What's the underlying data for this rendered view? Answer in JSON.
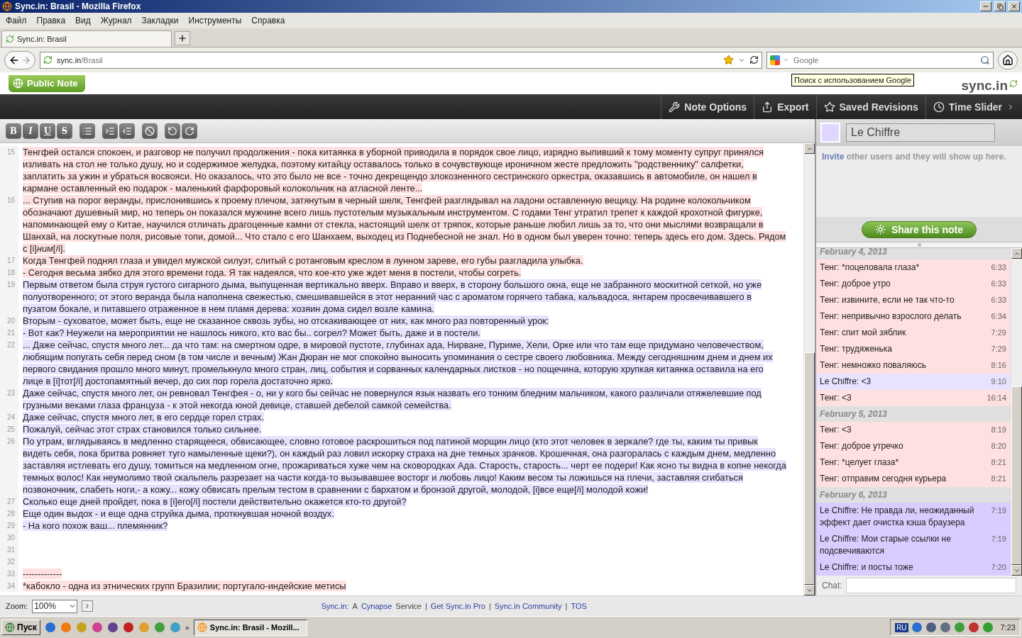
{
  "window": {
    "title": "Sync.in: Brasil - Mozilla Firefox"
  },
  "menu": [
    "Файл",
    "Правка",
    "Вид",
    "Журнал",
    "Закладки",
    "Инструменты",
    "Справка"
  ],
  "tabs": [
    {
      "label": "Sync.in: Brasil",
      "selected": true
    }
  ],
  "address_bar": {
    "host": "sync.in",
    "path": "/Brasil"
  },
  "search": {
    "placeholder": "Google"
  },
  "tooltip": "Поиск с использованием Google",
  "app": {
    "note_badge": "Public Note",
    "logo": "sync.in"
  },
  "note_toolbar": [
    "Note Options",
    "Export",
    "Saved Revisions",
    "Time Slider"
  ],
  "format_buttons": [
    {
      "kind": "bold",
      "label": "B"
    },
    {
      "kind": "italic",
      "label": "I"
    },
    {
      "kind": "underline",
      "label": "U"
    },
    {
      "kind": "strike",
      "label": "S"
    }
  ],
  "editor": {
    "paragraphs": [
      {
        "number": "15",
        "color": "#ffe0e0",
        "parts": [
          {
            "text": "Тенгфей остался спокоен, и разговор не получил продолжения - пока китаянка в уборной приводила в порядок свое лицо, изрядно выпивший к тому моменту супруг принялся изливать на стол не только душу, но и содержимое желудка, поэтому китайцу оставалось только в сочувствующе ироничном жесте предложить \"родственнику\" салфетки, заплатить за ужин и убраться восвояси. Но оказалось, что это было не все - точно декрещендо злокозненного сестринского оркестра, оказавшись в автомобиле, он нашел в кармане оставленный ею подарок - маленький фарфоровый колокольчик на атласной ленте...",
            "italic": false
          }
        ]
      },
      {
        "number": "16",
        "color": "#ffe0e0",
        "parts": [
          {
            "text": "... Ступив на порог веранды, прислонившись к проему плечом, затянутым в черный шелк, Тенгфей разглядывал на ладони оставленную вещицу. На родине колокольчиком обозначают душевный мир, но теперь он показался мужчине всего лишь пустотелым музыкальным инструментом. С годами Тенг утратил трепет к каждой крохотной фигурке, напоминающей ему о Китае, научился отличать драгоценные камни от стекла, настоящий шелк от тряпок, которые раньше любил лишь за то, что они мыслями возвращали в Шанхай, на лоскутные поля, рисовые топи, домой... Что стало с его Шанхаем, выходец из Поднебесной не знал. Но в одном был уверен точно: теперь здесь его дом. Здесь. Рядом с [i]",
            "italic": false
          },
          {
            "text": "ним",
            "italic": true
          },
          {
            "text": "[/i].",
            "italic": false
          }
        ]
      },
      {
        "number": "17",
        "color": "#ffe0e0",
        "parts": [
          {
            "text": "Когда Тенгфей поднял глаза и увидел мужской силуэт, слитый с ротанговым креслом в лунном зареве, его губы разгладила улыбка.",
            "italic": false
          }
        ]
      },
      {
        "number": "18",
        "color": "#ffe0e0",
        "parts": [
          {
            "text": "- Сегодня весьма зябко для этого времени года. Я так надеялся, что кое-кто уже ждет меня в постели, чтобы согреть.",
            "italic": false
          }
        ]
      },
      {
        "number": "19",
        "color": "#e8e2ff",
        "parts": [
          {
            "text": "Первым ответом была струя густого сигарного дыма, выпущенная вертикально вверх. Вправо и вверх, в сторону большого окна, еще не забранного москитной сеткой, но уже полуотворенного; от этого веранда была наполнена свежестью, смешивавшейся в этот неранний час с ароматом горячего табака, кальвадоса, янтарем просвечивавшего в пузатом бокале, и питавшего отраженное в нем пламя дерева: хозяин дома сидел возле камина.",
            "italic": false
          }
        ]
      },
      {
        "number": "20",
        "color": "#e8e2ff",
        "parts": [
          {
            "text": "Вторым - суховатое, может быть, еще не сказанное сквозь зубы, но отскакивающее от них, как много раз повторенный урок:",
            "italic": false
          }
        ]
      },
      {
        "number": "21",
        "color": "#e8e2ff",
        "parts": [
          {
            "text": "- Вот как? Неужели на мероприятии не нашлось никого, кто вас бы.. согрел? Может быть, даже и в постели.",
            "italic": false
          }
        ]
      },
      {
        "number": "22",
        "color": "#e8e2ff",
        "parts": [
          {
            "text": "... Даже сейчас, спустя много лет... да что там: на смертном одре, в мировой пустоте, глубинах ада, Нирване, Пуриме, Хели, Орке или что там еще придумано человечеством, любящим попугать себя перед сном (в том числе и вечным) Жан Дюран не мог спокойно выносить упоминания о сестре своего любовника. Между сегодняшним днем и днем их первого свидания прошло много минут, промелькнуло много стран, лиц, события и сорванных календарных листков - но пощечина, которую хрупкая китаянка оставила на его лице в [i]тот[/i] достопамятный вечер, до сих пор горела достаточно ярко.",
            "italic": false
          }
        ]
      },
      {
        "number": "23",
        "color": "#e8e2ff",
        "parts": [
          {
            "text": "Даже сейчас, спустя много лет, он ревновал Тенгфея - о, ни у кого бы сейчас не повернулся язык назвать его тонким бледним мальчиком, какого различали отяжелевшие под грузными веками глаза француза - к этой некогда юной девице, ставшей дебелой самкой семейства.",
            "italic": false
          }
        ]
      },
      {
        "number": "24",
        "color": "#e8e2ff",
        "parts": [
          {
            "text": "Даже сейчас, спустя много лет, в его сердце горел страх.",
            "italic": false
          }
        ]
      },
      {
        "number": "25",
        "color": "#e8e2ff",
        "parts": [
          {
            "text": "Пожалуй, сейчас этот страх становился только сильнее.",
            "italic": false
          }
        ]
      },
      {
        "number": "26",
        "color": "#e8e2ff",
        "parts": [
          {
            "text": "По утрам, вглядываясь в медленно старящееся, обвисающее, словно готовое раскрошиться под патиной морщин лицо (кто этот человек в зеркале? где ты, каким ты привык видеть себя, пока бритва ровняет туго намыленные щеки?), он каждый раз ловил искорку страха на дне темных зрачков. Крошечная, она разгоралась с каждым днем, медленно заставляя истлевать его душу, томиться на медленном огне, прожариваться хуже чем на сковородках Ада. Старость, старость... черт ее подери! Как ясно ты видна в копне некогда темных волос! Как неумолимо твой скальпель разрезает на части когда-то вызывавшее восторг и любовь лицо! Каким весом ты ложишься на плечи, заставляя сгибаться позвоночник, слабеть ноги,- а кожу... кожу обвисать прелым тестом в сравнении с бархатом и бронзой другой, молодой, [i]все еще[/i] молодой кожи!",
            "italic": false
          }
        ]
      },
      {
        "number": "27",
        "color": "#e8e2ff",
        "parts": [
          {
            "text": "Сколько еще дней пройдет, пока в [i]его[/i] постели действительно окажется кто-то другой?",
            "italic": false
          }
        ]
      },
      {
        "number": "28",
        "color": "#e8e2ff",
        "parts": [
          {
            "text": "Еще один выдох - и еще одна струйка дыма, проткнувшая ночной воздух.",
            "italic": false
          }
        ]
      },
      {
        "number": "29",
        "color": "#e8e2ff",
        "parts": [
          {
            "text": "- На кого похож ваш... племянник?",
            "italic": false
          }
        ]
      },
      {
        "number": "30"
      },
      {
        "number": "31"
      },
      {
        "number": "32"
      },
      {
        "number": "33",
        "color": "#ffe0e0",
        "parts": [
          {
            "text": "-------------",
            "italic": false
          }
        ]
      },
      {
        "number": "34",
        "color": "#ffe0e0",
        "parts": [
          {
            "text": "*кабокло - одна из этнических групп Бразилии; португало-индейские метисы",
            "italic": false
          }
        ]
      }
    ]
  },
  "user": {
    "name": "Le Chiffre",
    "color": "#e0d6ff"
  },
  "invite": {
    "link": "Invite",
    "text": "other users and they will show up here."
  },
  "share_button": "Share this note",
  "chat": [
    {
      "kind": "date",
      "text": "February 4, 2013"
    },
    {
      "kind": "message",
      "text": "Тенг: *поцеловала глаза*",
      "time": "6:33",
      "color": "#ffe0e0"
    },
    {
      "kind": "message",
      "text": "Тенг: доброе утро",
      "time": "6:33",
      "color": "#ffe0e0"
    },
    {
      "kind": "message",
      "text": "Тенг: извините, если не так что-то",
      "time": "6:33",
      "color": "#ffe0e0"
    },
    {
      "kind": "message",
      "text": "Тенг: непривычно взрослого делать",
      "time": "6:34",
      "color": "#ffe0e0"
    },
    {
      "kind": "message",
      "text": "Тенг: спит мой зяблик",
      "time": "7:29",
      "color": "#ffe0e0"
    },
    {
      "kind": "message",
      "text": "Тенг: трудяженька",
      "time": "7:29",
      "color": "#ffe0e0"
    },
    {
      "kind": "message",
      "text": "Тенг: немножко поваляюсь",
      "time": "8:16",
      "color": "#ffe0e0"
    },
    {
      "kind": "message",
      "text": "Le Chiffre: <3",
      "time": "9:10",
      "color": "#e8e2ff"
    },
    {
      "kind": "message",
      "text": "Тенг: <3",
      "time": "16:14",
      "color": "#ffe0e0"
    },
    {
      "kind": "date",
      "text": "February 5, 2013"
    },
    {
      "kind": "message",
      "text": "Тенг: <3",
      "time": "8:19",
      "color": "#ffe0e0"
    },
    {
      "kind": "message",
      "text": "Тенг: доброе утречко",
      "time": "8:20",
      "color": "#ffe0e0"
    },
    {
      "kind": "message",
      "text": "Тенг: *целует глаза*",
      "time": "8:21",
      "color": "#ffe0e0"
    },
    {
      "kind": "message",
      "text": "Тенг: отправим сегодня курьера",
      "time": "8:21",
      "color": "#ffe0e0"
    },
    {
      "kind": "date",
      "text": "February 6, 2013"
    },
    {
      "kind": "message",
      "text": "Le Chiffre: Не правда ли, неожиданный эффект дает очистка кэша браузера",
      "time": "7:19",
      "color": "#d9ccff"
    },
    {
      "kind": "message",
      "text": "Le Chiffre: Мои старые ссылки не подсвечиваются",
      "time": "7:19",
      "color": "#d9ccff"
    },
    {
      "kind": "message",
      "text": "Le Chiffre: и посты тоже",
      "time": "7:20",
      "color": "#d9ccff"
    }
  ],
  "chat_label": "Chat:",
  "zoom": {
    "label": "Zoom:",
    "value": "100%"
  },
  "footer": [
    {
      "kind": "link",
      "text": "Sync.in:"
    },
    {
      "kind": "plain",
      "text": "A"
    },
    {
      "kind": "link",
      "text": "Cynapse"
    },
    {
      "kind": "plain",
      "text": "Service"
    },
    {
      "kind": "sep",
      "text": "|"
    },
    {
      "kind": "link",
      "text": "Get Sync.in Pro"
    },
    {
      "kind": "sep",
      "text": "|"
    },
    {
      "kind": "link",
      "text": "Sync.in Community"
    },
    {
      "kind": "sep",
      "text": "|"
    },
    {
      "kind": "link",
      "text": "TOS"
    }
  ],
  "taskbar": {
    "start": "Пуск",
    "more": "»",
    "task": "Sync.in: Brasil - Mozill...",
    "lang": "RU",
    "clock": "7:23"
  }
}
